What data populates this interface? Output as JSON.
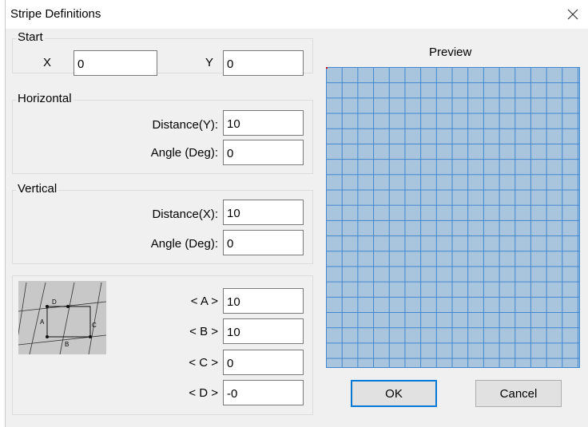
{
  "window": {
    "title": "Stripe Definitions",
    "close_icon": "close-icon"
  },
  "start": {
    "label": "Start",
    "x_label": "X",
    "x_value": "0",
    "y_label": "Y",
    "y_value": "0"
  },
  "horizontal": {
    "label": "Horizontal",
    "distance_label": "Distance(Y):",
    "distance_value": "10",
    "angle_label": "Angle (Deg):",
    "angle_value": "0"
  },
  "vertical": {
    "label": "Vertical",
    "distance_label": "Distance(X):",
    "distance_value": "10",
    "angle_label": "Angle (Deg):",
    "angle_value": "0"
  },
  "params": {
    "diagram_letters": {
      "a": "A",
      "b": "B",
      "c": "C",
      "d": "D"
    },
    "a_label": "< A >",
    "a_value": "10",
    "b_label": "< B >",
    "b_value": "10",
    "c_label": "< C >",
    "c_value": "0",
    "d_label": "< D >",
    "d_value": "-0"
  },
  "preview": {
    "title": "Preview",
    "fill_color": "#a9c5dd",
    "line_color": "#3f86d1"
  },
  "buttons": {
    "ok": "OK",
    "cancel": "Cancel"
  }
}
